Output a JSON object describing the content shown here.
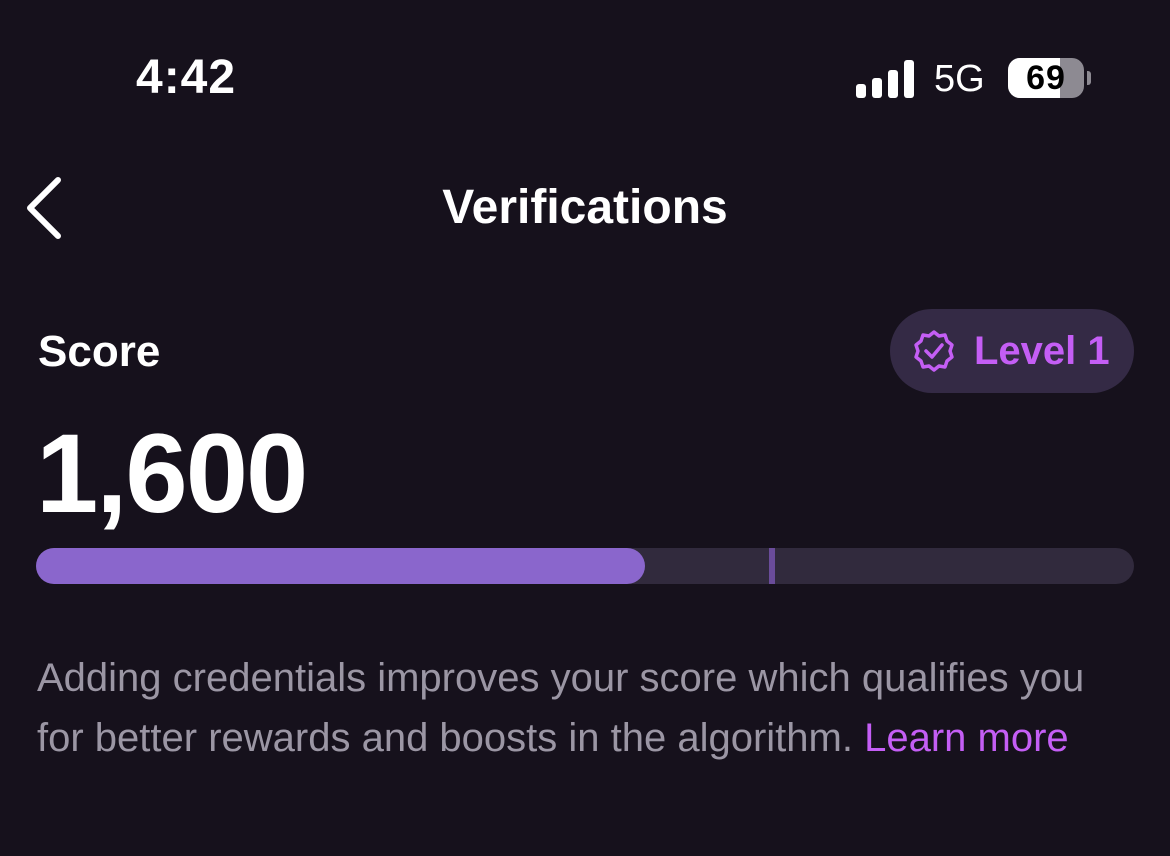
{
  "status_bar": {
    "time": "4:42",
    "network": "5G",
    "battery_percent": "69",
    "battery_level": 0.69,
    "signal_icon": "cellular-signal-icon"
  },
  "nav": {
    "back_icon": "chevron-left-icon",
    "title": "Verifications"
  },
  "score": {
    "label": "Score",
    "value": "1,600",
    "level_label": "Level 1",
    "level_icon": "verified-badge-icon",
    "progress": 0.555,
    "milestone": 0.668
  },
  "description": {
    "text": "Adding credentials improves your score which qualifies you for better rewards and boosts in the algorithm. ",
    "link": "Learn more"
  },
  "colors": {
    "background": "#16111c",
    "accent": "#c45ef5",
    "progress_fill": "#8a66cc",
    "progress_track": "#312a3d",
    "badge_background": "#342a45",
    "muted_text": "#9b96a4"
  }
}
